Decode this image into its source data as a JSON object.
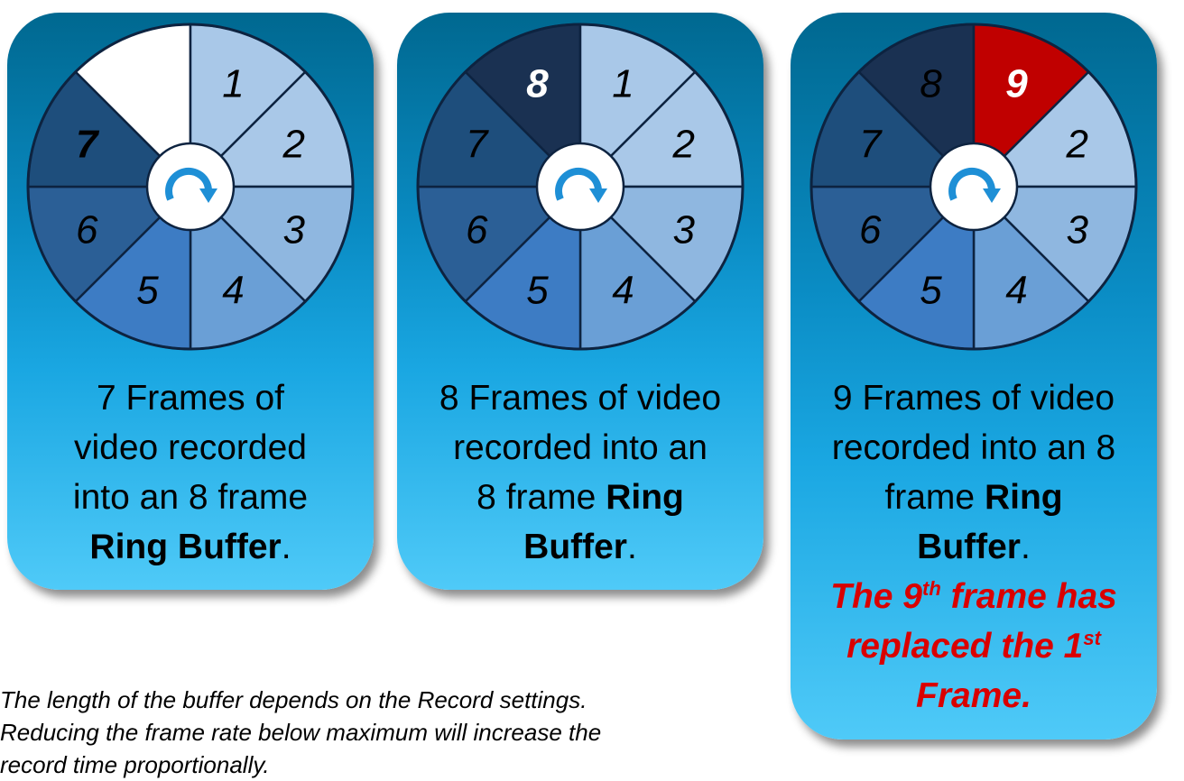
{
  "panels": [
    {
      "id": "panel-7",
      "segments": [
        {
          "label": "",
          "color": "#ffffff",
          "text_color": "#000000",
          "bold": false
        },
        {
          "label": "1",
          "color": "#a9c8e8",
          "text_color": "#000000",
          "bold": false
        },
        {
          "label": "2",
          "color": "#a9c8e8",
          "text_color": "#000000",
          "bold": false
        },
        {
          "label": "3",
          "color": "#8fb7e0",
          "text_color": "#000000",
          "bold": false
        },
        {
          "label": "4",
          "color": "#6a9fd6",
          "text_color": "#000000",
          "bold": false
        },
        {
          "label": "5",
          "color": "#3d7cc4",
          "text_color": "#000000",
          "bold": false
        },
        {
          "label": "6",
          "color": "#2b5f96",
          "text_color": "#000000",
          "bold": false
        },
        {
          "label": "7",
          "color": "#1e4e7c",
          "text_color": "#000000",
          "bold": true
        }
      ],
      "caption_lines": [
        [
          {
            "text": "7 Frames of",
            "bold": false
          }
        ],
        [
          {
            "text": "video recorded",
            "bold": false
          }
        ],
        [
          {
            "text": "into an 8 frame",
            "bold": false
          }
        ],
        [
          {
            "text": "Ring Buffer",
            "bold": true
          },
          {
            "text": ".",
            "bold": false
          }
        ]
      ]
    },
    {
      "id": "panel-8",
      "segments": [
        {
          "label": "8",
          "color": "#1a3152",
          "text_color": "#ffffff",
          "bold": true
        },
        {
          "label": "1",
          "color": "#a9c8e8",
          "text_color": "#000000",
          "bold": false
        },
        {
          "label": "2",
          "color": "#a9c8e8",
          "text_color": "#000000",
          "bold": false
        },
        {
          "label": "3",
          "color": "#8fb7e0",
          "text_color": "#000000",
          "bold": false
        },
        {
          "label": "4",
          "color": "#6a9fd6",
          "text_color": "#000000",
          "bold": false
        },
        {
          "label": "5",
          "color": "#3d7cc4",
          "text_color": "#000000",
          "bold": false
        },
        {
          "label": "6",
          "color": "#2b5f96",
          "text_color": "#000000",
          "bold": false
        },
        {
          "label": "7",
          "color": "#1e4e7c",
          "text_color": "#000000",
          "bold": false
        }
      ],
      "caption_lines": [
        [
          {
            "text": "8 Frames of video",
            "bold": false
          }
        ],
        [
          {
            "text": "recorded into an",
            "bold": false
          }
        ],
        [
          {
            "text": "8 frame ",
            "bold": false
          },
          {
            "text": "Ring",
            "bold": true
          }
        ],
        [
          {
            "text": "Buffer",
            "bold": true
          },
          {
            "text": ".",
            "bold": false
          }
        ]
      ]
    },
    {
      "id": "panel-9",
      "segments": [
        {
          "label": "8",
          "color": "#1a3152",
          "text_color": "#000000",
          "bold": false
        },
        {
          "label": "9",
          "color": "#c00000",
          "text_color": "#ffffff",
          "bold": true
        },
        {
          "label": "2",
          "color": "#a9c8e8",
          "text_color": "#000000",
          "bold": false
        },
        {
          "label": "3",
          "color": "#8fb7e0",
          "text_color": "#000000",
          "bold": false
        },
        {
          "label": "4",
          "color": "#6a9fd6",
          "text_color": "#000000",
          "bold": false
        },
        {
          "label": "5",
          "color": "#3d7cc4",
          "text_color": "#000000",
          "bold": false
        },
        {
          "label": "6",
          "color": "#2b5f96",
          "text_color": "#000000",
          "bold": false
        },
        {
          "label": "7",
          "color": "#1e4e7c",
          "text_color": "#000000",
          "bold": false
        }
      ],
      "caption_lines": [
        [
          {
            "text": "9 Frames of video",
            "bold": false
          }
        ],
        [
          {
            "text": "recorded into an 8",
            "bold": false
          }
        ],
        [
          {
            "text": "frame ",
            "bold": false
          },
          {
            "text": "Ring",
            "bold": true
          }
        ],
        [
          {
            "text": "Buffer",
            "bold": true
          },
          {
            "text": ".",
            "bold": false
          }
        ]
      ],
      "note": {
        "line1_a": "The 9",
        "line1_sup": "th",
        "line1_b": " frame has",
        "line2_a": "replaced the 1",
        "line2_sup": "st",
        "line3": "Frame."
      }
    }
  ],
  "footnote": {
    "line1": "The length of the buffer depends on the Record settings.",
    "line2": "Reducing the frame rate below maximum will increase the",
    "line3": "record time proportionally."
  },
  "colors": {
    "card_top": "#006890",
    "card_bottom": "#4fcaf8",
    "ring_outline": "#0d2340",
    "note_red": "#d90000",
    "arrow_blue": "#1e8fd6"
  },
  "icons": {
    "center": "rotate-clockwise-arrow-icon"
  }
}
